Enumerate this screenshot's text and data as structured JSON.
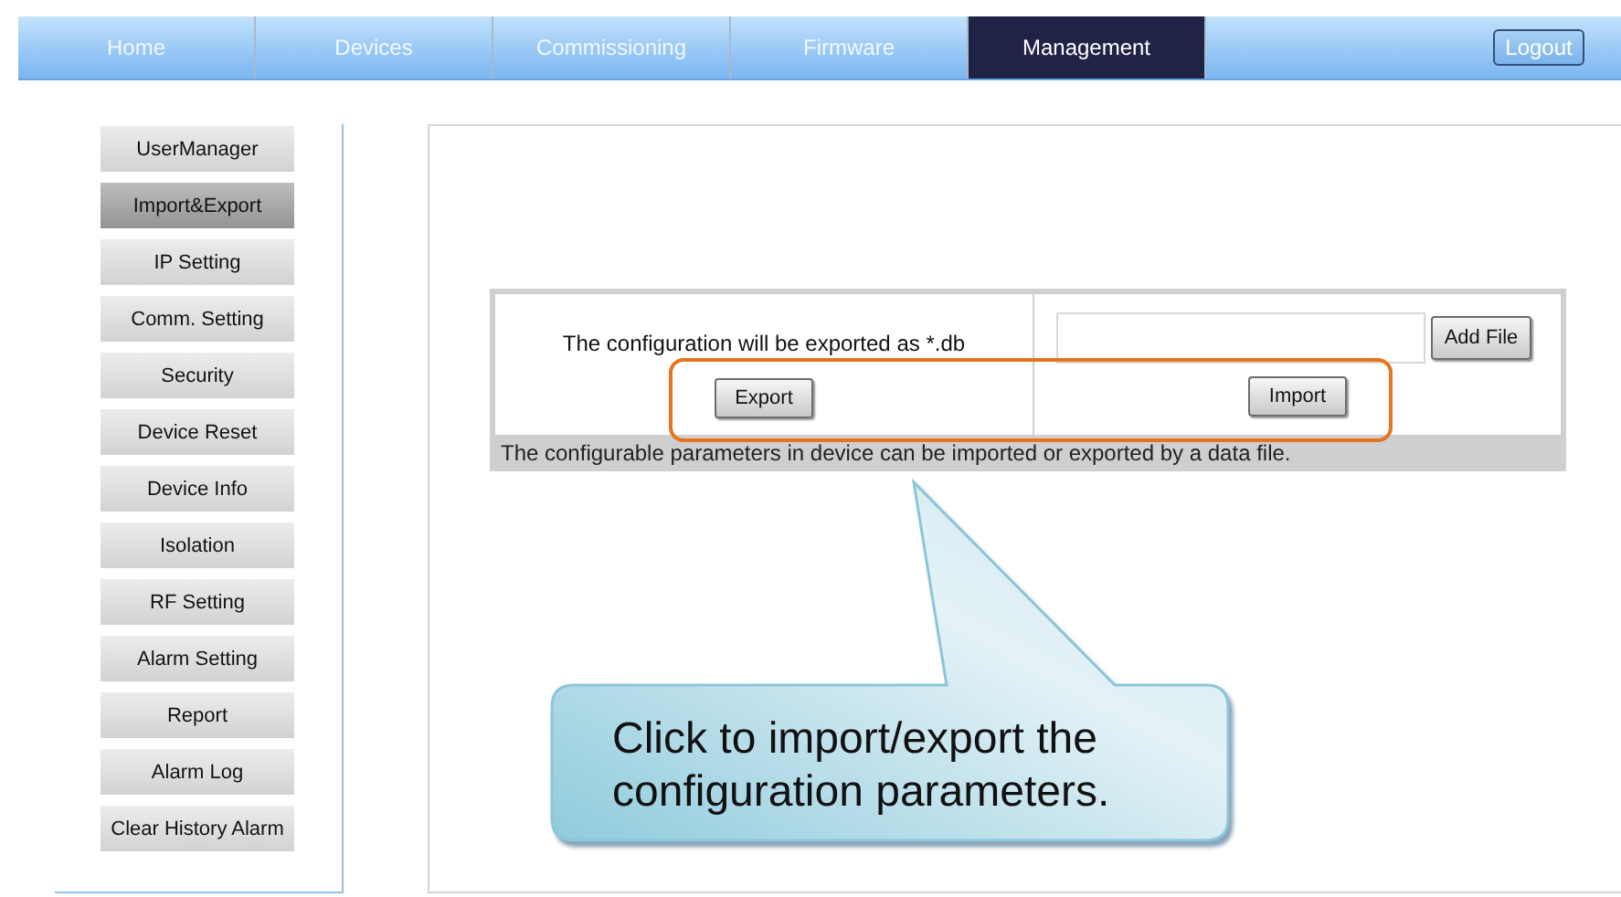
{
  "nav": {
    "tabs": [
      {
        "label": "Home",
        "selected": false
      },
      {
        "label": "Devices",
        "selected": false
      },
      {
        "label": "Commissioning",
        "selected": false
      },
      {
        "label": "Firmware",
        "selected": false
      },
      {
        "label": "Management",
        "selected": true
      }
    ],
    "logout": "Logout"
  },
  "sidebar": {
    "items": [
      {
        "label": "UserManager",
        "selected": false
      },
      {
        "label": "Import&Export",
        "selected": true
      },
      {
        "label": "IP Setting",
        "selected": false
      },
      {
        "label": "Comm. Setting",
        "selected": false
      },
      {
        "label": "Security",
        "selected": false
      },
      {
        "label": "Device Reset",
        "selected": false
      },
      {
        "label": "Device Info",
        "selected": false
      },
      {
        "label": "Isolation",
        "selected": false
      },
      {
        "label": "RF Setting",
        "selected": false
      },
      {
        "label": "Alarm Setting",
        "selected": false
      },
      {
        "label": "Report",
        "selected": false
      },
      {
        "label": "Alarm Log",
        "selected": false
      },
      {
        "label": "Clear History Alarm",
        "selected": false
      }
    ]
  },
  "panel": {
    "export_note": "The configuration will be exported as *.db",
    "export_button": "Export",
    "add_file_button": "Add File",
    "import_button": "Import",
    "footer": "The configurable parameters in device can be imported or exported by a data file."
  },
  "callout": "Click to import/export the configuration parameters."
}
